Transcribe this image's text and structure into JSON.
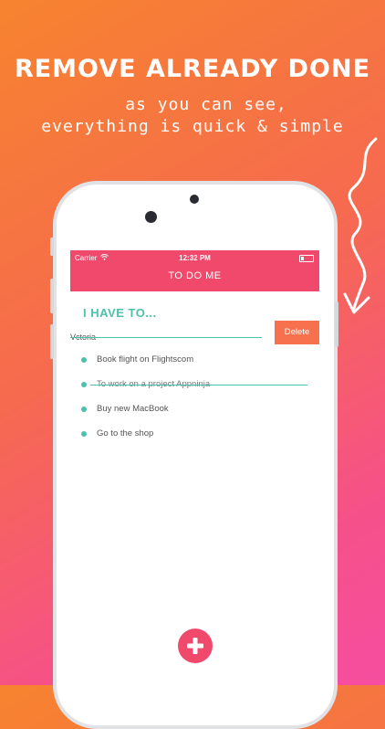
{
  "promo": {
    "headline": "REMOVE ALREADY DONE",
    "subline1": "as you can see,",
    "subline2": "everything is quick & simple"
  },
  "status_bar": {
    "carrier": "Carrier",
    "time": "12:32 PM"
  },
  "app": {
    "title": "TO DO ME",
    "section_title": "I HAVE TO...",
    "swiped_item": {
      "text": "Vctoria",
      "action_label": "Delete",
      "completed": true
    },
    "items": [
      {
        "text": "Book flight on Flightscom",
        "completed": false
      },
      {
        "text": "To work on a project Appninja",
        "completed": true
      },
      {
        "text": "Buy new MacBook",
        "completed": false
      },
      {
        "text": "Go to the shop",
        "completed": false
      }
    ],
    "add_button_icon": "plus-icon"
  },
  "colors": {
    "gradient_start": "#f7832f",
    "gradient_end": "#f64ea0",
    "header": "#f0496c",
    "accent": "#4cc1ab",
    "delete": "#f7714e"
  }
}
